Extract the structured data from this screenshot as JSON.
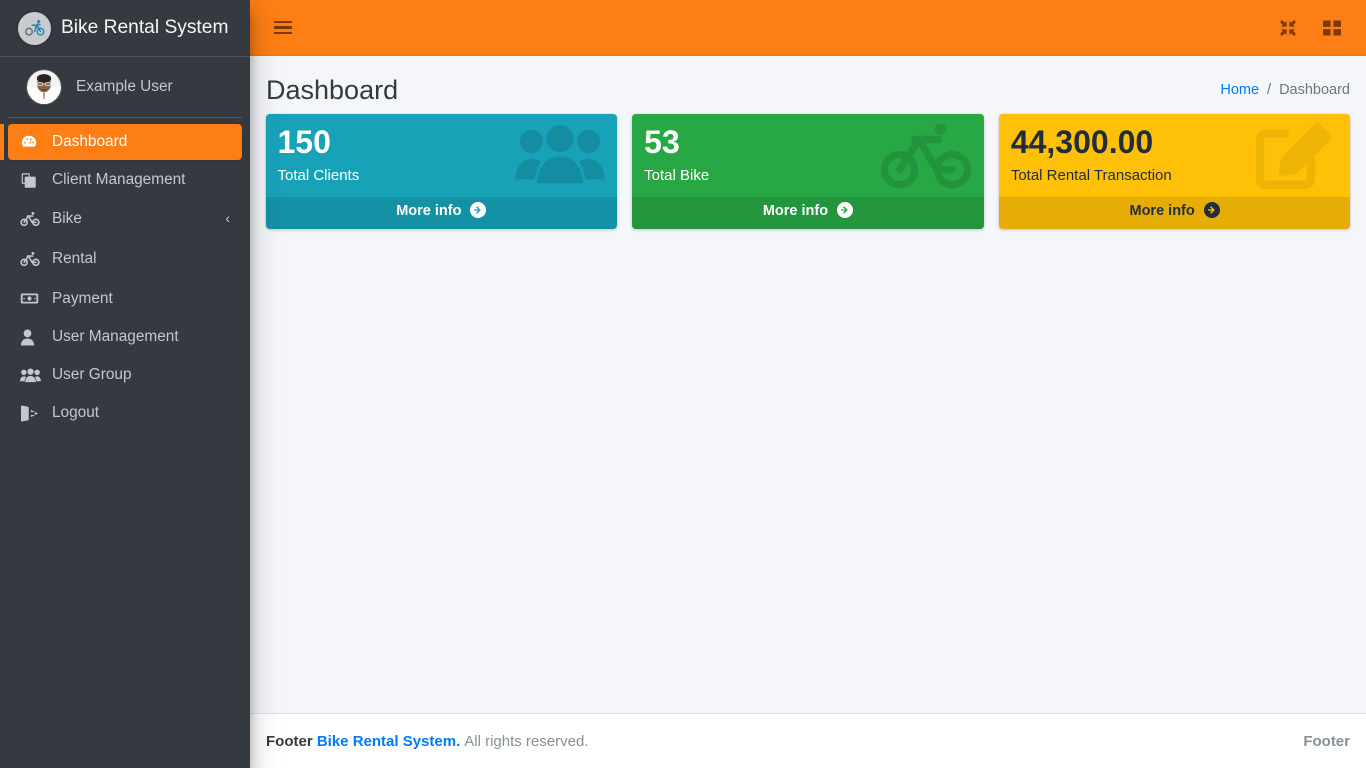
{
  "brand": {
    "title": "Bike Rental System",
    "logo_icon": "bike-logo-icon"
  },
  "user_panel": {
    "name": "Example User",
    "avatar_icon": "user-avatar"
  },
  "sidebar": {
    "items": [
      {
        "label": "Dashboard",
        "icon": "tachometer-icon",
        "active": true,
        "arrow": ""
      },
      {
        "label": "Client Management",
        "icon": "copy-files-icon",
        "active": false,
        "arrow": ""
      },
      {
        "label": "Bike",
        "icon": "bicycle-icon",
        "active": false,
        "arrow": "‹"
      },
      {
        "label": "Rental",
        "icon": "bicycle-icon",
        "active": false,
        "arrow": ""
      },
      {
        "label": "Payment",
        "icon": "money-bill-icon",
        "active": false,
        "arrow": ""
      },
      {
        "label": "User Management",
        "icon": "user-icon",
        "active": false,
        "arrow": ""
      },
      {
        "label": "User Group",
        "icon": "users-icon",
        "active": false,
        "arrow": ""
      },
      {
        "label": "Logout",
        "icon": "sign-out-icon",
        "active": false,
        "arrow": ""
      }
    ]
  },
  "navbar": {
    "menu_toggle_icon": "hamburger-icon",
    "compress_icon": "compress-icon",
    "grid_icon": "th-large-grid-icon"
  },
  "content_header": {
    "title": "Dashboard",
    "breadcrumb": {
      "home": "Home",
      "separator": "/",
      "current": "Dashboard"
    }
  },
  "info_boxes": [
    {
      "value": "150",
      "label": "Total Clients",
      "footer": "More info",
      "icon": "users-icon",
      "color": "#17a2b8",
      "theme": "bg-teal"
    },
    {
      "value": "53",
      "label": "Total Bike",
      "footer": "More info",
      "icon": "bicycle-icon",
      "color": "#28a745",
      "theme": "bg-green"
    },
    {
      "value": "44,300.00",
      "label": "Total Rental Transaction",
      "footer": "More info",
      "icon": "edit-pencil-square-icon",
      "color": "#ffc107",
      "theme": "bg-yellow"
    }
  ],
  "footer": {
    "strong": "Footer",
    "link": "Bike Rental System.",
    "rest": "All rights reserved.",
    "right": "Footer"
  },
  "colors": {
    "accent_orange": "#fd7e14",
    "sidebar_dark": "#343a40",
    "link_blue": "#007bff",
    "content_bg": "#f4f6f9"
  }
}
